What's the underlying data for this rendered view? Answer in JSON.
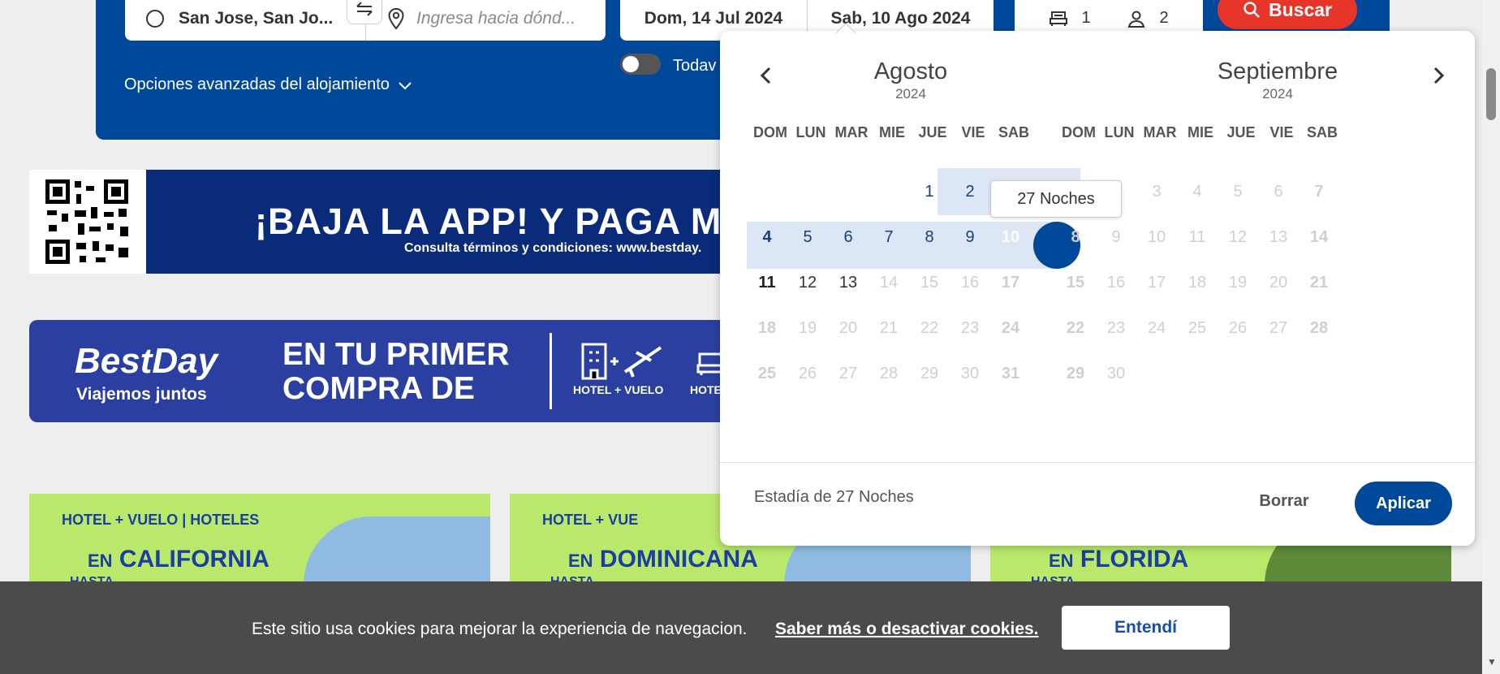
{
  "search": {
    "origin": "San Jose, San Jo...",
    "destination_placeholder": "Ingresa hacia dónd...",
    "checkin": "Dom, 14 Jul 2024",
    "checkout": "Sab, 10 Ago 2024",
    "rooms": "1",
    "guests": "2",
    "button": "Buscar",
    "toggle_label": "Todav",
    "advanced": "Opciones avanzadas del alojamiento"
  },
  "banners": {
    "app_title": "¡BAJA LA APP! Y PAGA M",
    "app_sub": "Consulta términos y condiciones: www.bestday.",
    "bd_logo": "BestDay",
    "bd_tagline": "Viajemos juntos",
    "bd_promo_l1": "EN TU PRIMER",
    "bd_promo_l2": "COMPRA DE",
    "bd_hv": "HOTEL + VUELO",
    "bd_hv2": "HOTE"
  },
  "promos": [
    {
      "top": "HOTEL + VUELO | HOTELES",
      "en": "EN",
      "place": "CALIFORNIA",
      "hasta": "HASTA"
    },
    {
      "top": "HOTEL + VUE",
      "en": "EN",
      "place": "DOMINICANA",
      "hasta": "HASTA"
    },
    {
      "top": "",
      "en": "EN",
      "place": "FLORIDA",
      "hasta": "HASTA"
    }
  ],
  "calendar": {
    "weekdays": [
      "DOM",
      "LUN",
      "MAR",
      "MIE",
      "JUE",
      "VIE",
      "SAB"
    ],
    "months": [
      {
        "name": "Agosto",
        "year": "2024"
      },
      {
        "name": "Septiembre",
        "year": "2024"
      }
    ],
    "tooltip": "27 Noches",
    "stay": "Estadía de 27 Noches",
    "clear": "Borrar",
    "apply": "Aplicar"
  },
  "cookie": {
    "text": "Este sitio usa cookies para mejorar la experiencia de navegacion.",
    "link": "Saber más o desactivar cookies.",
    "button": "Entendí"
  },
  "colors": {
    "brand_blue": "#00489a",
    "search_red": "#e8352a",
    "range_fill": "#dde6f4",
    "promo_green": "#b9e86b"
  }
}
